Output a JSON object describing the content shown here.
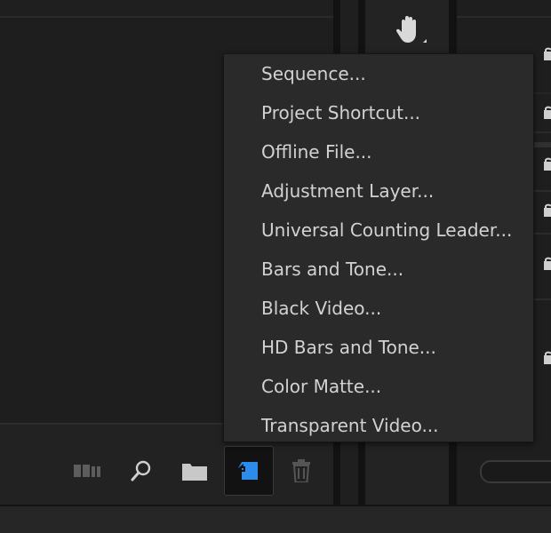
{
  "menu": {
    "items": [
      {
        "label": "Sequence..."
      },
      {
        "label": "Project Shortcut..."
      },
      {
        "label": "Offline File..."
      },
      {
        "label": "Adjustment Layer..."
      },
      {
        "label": "Universal Counting Leader..."
      },
      {
        "label": "Bars and Tone..."
      },
      {
        "label": "Black Video..."
      },
      {
        "label": "HD Bars and Tone..."
      },
      {
        "label": "Color Matte..."
      },
      {
        "label": "Transparent Video..."
      }
    ]
  },
  "toolbar": {
    "buttons": [
      {
        "icon": "freeform-view-icon",
        "active": false
      },
      {
        "icon": "search-icon",
        "active": false
      },
      {
        "icon": "folder-icon",
        "active": false
      },
      {
        "icon": "new-item-icon",
        "active": true
      },
      {
        "icon": "trash-icon",
        "active": false
      }
    ]
  },
  "tools": {
    "current": "hand-tool-icon"
  },
  "colors": {
    "accent": "#2d8ceb",
    "menu_bg": "#2a2a2a",
    "menu_text": "#d2d2d2",
    "panel_bg": "#1e1e1e"
  }
}
